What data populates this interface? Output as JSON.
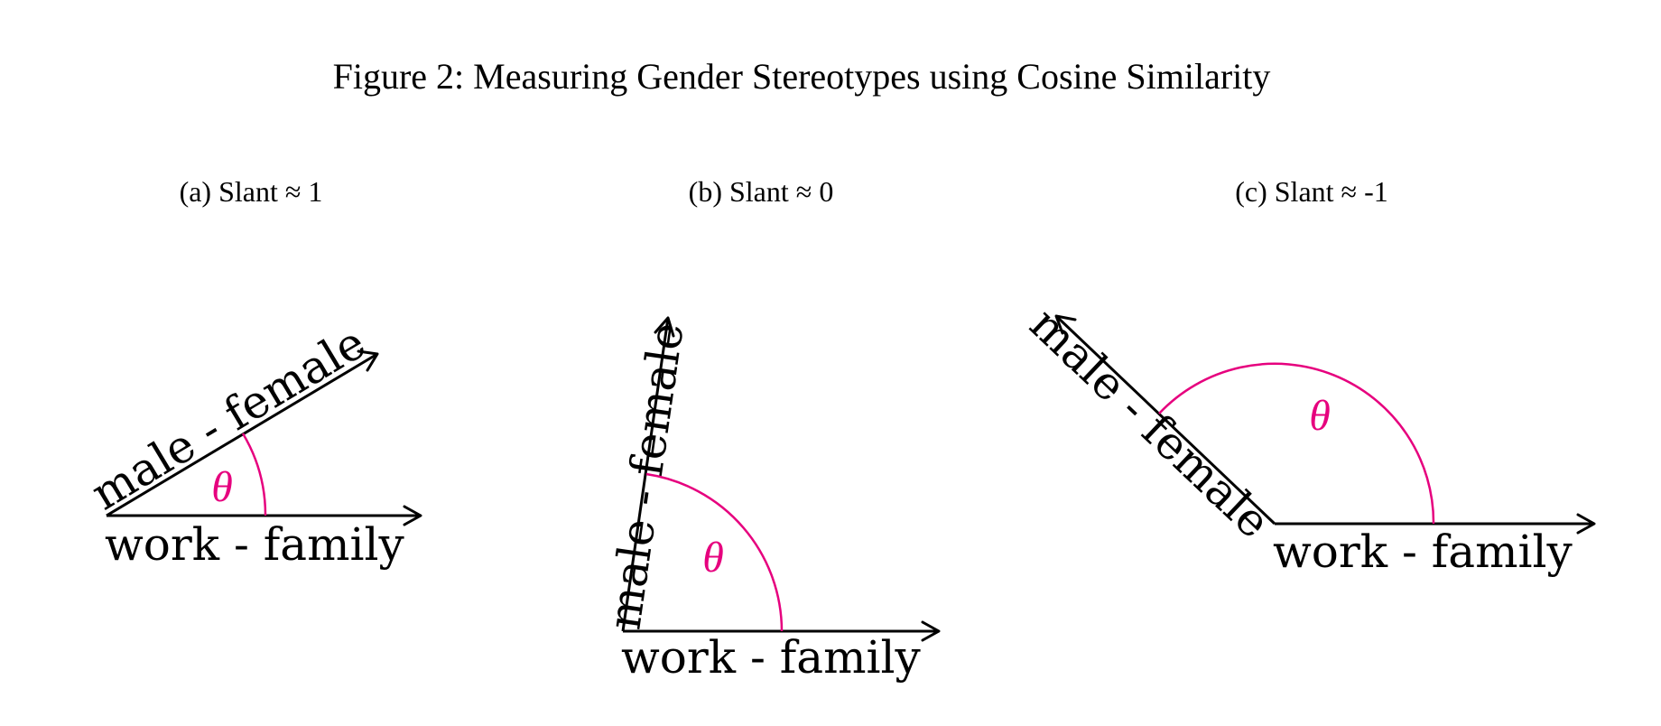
{
  "figure": {
    "title": "Figure 2: Measuring Gender Stereotypes using Cosine Similarity"
  },
  "panels": [
    {
      "caption": "(a) Slant ≈ 1",
      "vector_a_label": "male - female",
      "vector_b_label": "work - family",
      "angle_label": "θ"
    },
    {
      "caption": "(b) Slant ≈ 0",
      "vector_a_label": "male - female",
      "vector_b_label": "work - family",
      "angle_label": "θ"
    },
    {
      "caption": "(c) Slant ≈ -1",
      "vector_a_label": "male - female",
      "vector_b_label": "work - family",
      "angle_label": "θ"
    }
  ],
  "colors": {
    "angle_arc": "#e6007e",
    "vectors": "#000000"
  }
}
